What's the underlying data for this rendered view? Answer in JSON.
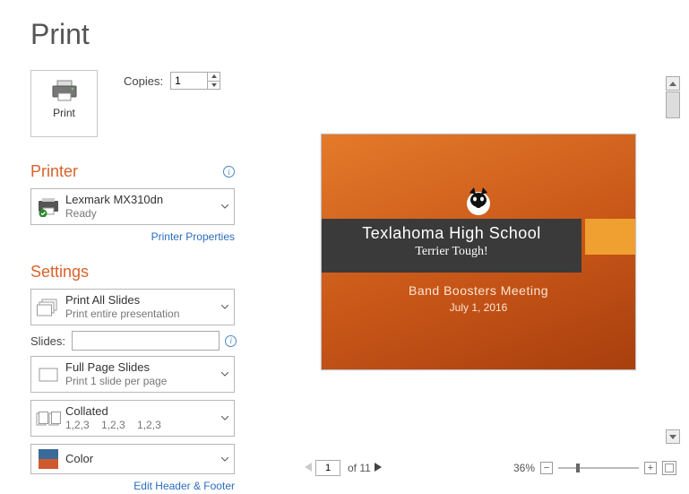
{
  "title": "Print",
  "print_button": {
    "label": "Print"
  },
  "copies": {
    "label": "Copies:",
    "value": "1"
  },
  "sections": {
    "printer_head": "Printer",
    "settings_head": "Settings"
  },
  "printer": {
    "name": "Lexmark MX310dn",
    "status": "Ready",
    "properties_link": "Printer Properties"
  },
  "settings": {
    "what": {
      "l1": "Print All Slides",
      "l2": "Print entire presentation"
    },
    "slides_label": "Slides:",
    "slides_value": "",
    "layout": {
      "l1": "Full Page Slides",
      "l2": "Print 1 slide per page"
    },
    "collate": {
      "l1": "Collated",
      "l2": "1,2,3    1,2,3    1,2,3"
    },
    "color": {
      "l1": "Color"
    },
    "edit_hf_link": "Edit Header & Footer"
  },
  "preview": {
    "slide_title": "Texlahoma High School",
    "slide_tagline": "Terrier Tough!",
    "slide_sub": "Band Boosters Meeting",
    "slide_date": "July 1, 2016",
    "page_current": "1",
    "page_of_prefix": "of ",
    "page_total": "11",
    "zoom_label": "36%"
  }
}
